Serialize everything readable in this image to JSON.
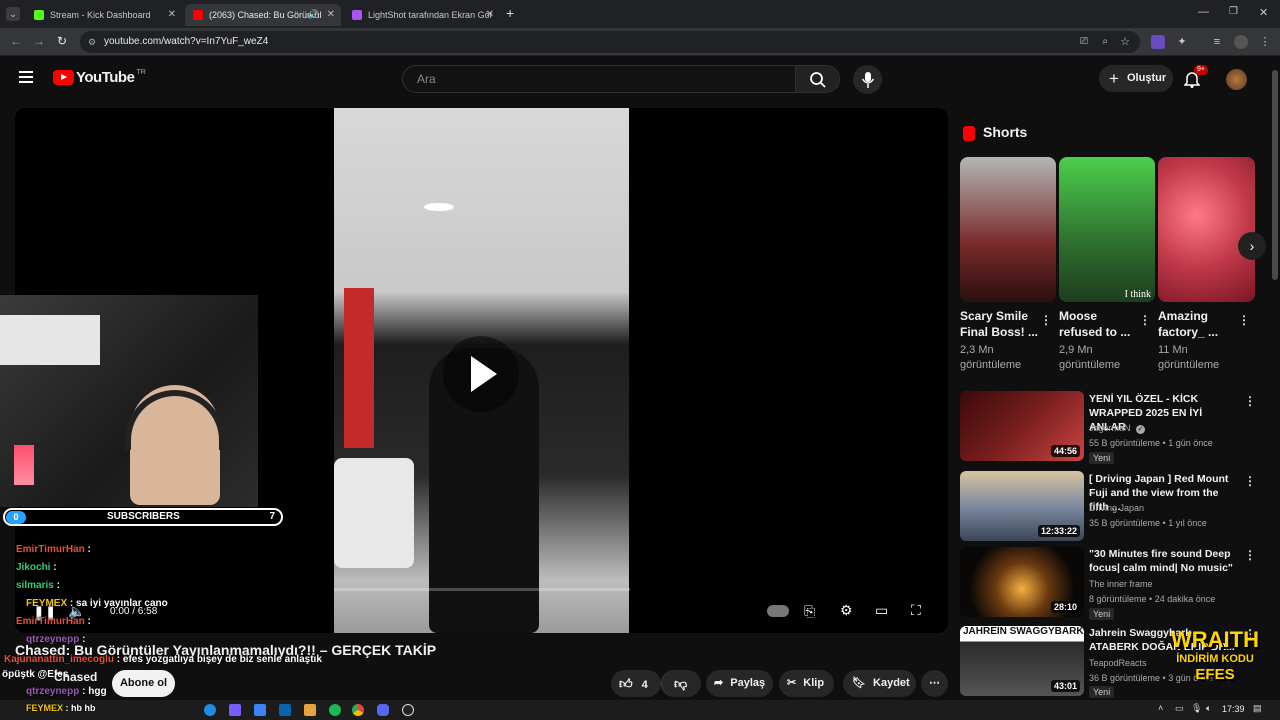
{
  "browser": {
    "tabs": [
      {
        "title": "Stream - Kick Dashboard",
        "color": "#53fc18"
      },
      {
        "title": "(2063) Chased: Bu Görüntül",
        "color": "#ff0000"
      },
      {
        "title": "LightShot tarafından Ekran Gör",
        "color": "#a855f7"
      }
    ],
    "new_tab": "+",
    "url": "youtube.com/watch?v=In7YuF_weZ4"
  },
  "youtube": {
    "logo_text": "YouTube",
    "region": "TR",
    "search_placeholder": "Ara",
    "create_label": "Oluştur",
    "notif_count": "9+"
  },
  "video": {
    "time": "0:00 / 6:58",
    "title": "Chased: Bu Görüntüler Yayınlanmamalıydı?!! – GERÇEK TAKİP",
    "channel": "Chased",
    "subscribe_label": "Abone ol",
    "likes": "4",
    "share_label": "Paylaş",
    "clip_label": "Klip",
    "save_label": "Kaydet"
  },
  "overlay": {
    "sub_count_left": "0",
    "sub_label": "SUBSCRIBERS",
    "sub_count_right": "7",
    "chat": [
      {
        "user": "EmirTimurHan",
        "msg": ":",
        "color": "#e74c3c"
      },
      {
        "user": "Jikochi",
        "msg": ":",
        "color": "#2ecc71"
      },
      {
        "user": "silmaris",
        "msg": ":",
        "color": "#2ecc71"
      },
      {
        "user": "FEYMEX",
        "msg": ": sa iyi yayınlar cano",
        "color": "#f1c40f"
      },
      {
        "user": "EmirTimurHan",
        "msg": ":",
        "color": "#e74c3c"
      },
      {
        "user": "qtrzeynepp",
        "msg": ":",
        "color": "#9b59b6"
      },
      {
        "user": "Kajunanattin_imecoglu",
        "msg": ": efes yozgatlıya bişey de biz senle anlaştık",
        "color": "#e74c3c"
      },
      {
        "user": "öpüştk @Efes",
        "msg": "",
        "color": "#ffffff"
      },
      {
        "user": "qtrzeynepp",
        "msg": ": hgg",
        "color": "#9b59b6"
      },
      {
        "user": "FEYMEX",
        "msg": ": hb hb",
        "color": "#f1c40f"
      }
    ]
  },
  "sidebar": {
    "shorts_label": "Shorts",
    "shorts": [
      {
        "title": "Scary Smile Final Boss! ...",
        "views": "2,3 Mn görüntüleme",
        "color": "#7a2a2a"
      },
      {
        "title": "Moose refused to ...",
        "views": "2,9 Mn görüntüleme",
        "color": "#2e6e2e"
      },
      {
        "title": "Amazing factory_ ...",
        "views": "11 Mn görüntüleme",
        "color": "#c0394a"
      }
    ],
    "short_caption": "I think",
    "videos": [
      {
        "title": "YENİ YIL ÖZEL - KİCK WRAPPED 2025 EN İYİ ANLAR",
        "channel": "JagermaN",
        "meta": "55 B görüntüleme • 1 gün önce",
        "duration": "44:56",
        "badge": "Yeni",
        "color": "#7a1e1e"
      },
      {
        "title": "[ Driving Japan ] Red Mount Fuji and the view from the fifth ...",
        "channel": "Driving Japan",
        "meta": "35 B görüntüleme • 1 yıl önce",
        "duration": "12:33:22",
        "badge": "",
        "color": "#4a5a72"
      },
      {
        "title": "\"30 Minutes fire sound Deep focus| calm mind| No music\"",
        "channel": "The inner frame",
        "meta": "8 görüntüleme • 24 dakika önce",
        "duration": "28:10",
        "badge": "Yeni",
        "color": "#1a1208"
      },
      {
        "title": "Jahrein Swaggybark ATABERK DOĞAN EKİP DR...",
        "channel": "TeapodReacts",
        "meta": "36 B görüntüleme • 3 gün önce",
        "duration": "43:01",
        "badge": "Yeni",
        "color": "#2a2a2a"
      }
    ],
    "thumb_caption": "JAHREIN SWAGGYBARK"
  },
  "promo": {
    "line1": "WRAITH",
    "line2": "İNDİRİM KODU",
    "line3": "EFES"
  },
  "taskbar": {
    "time": "17:39"
  }
}
